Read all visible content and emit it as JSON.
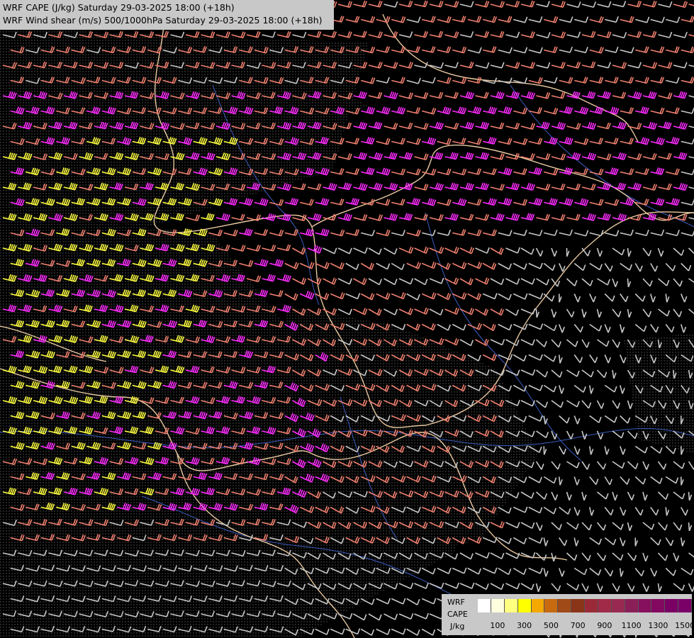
{
  "titles": {
    "line1": "WRF CAPE (J/kg) Saturday 29-03-2025 18:00 (+18h)",
    "line2": "WRF Wind shear (m/s) 500/1000hPa Saturday 29-03-2025 18:00 (+18h)"
  },
  "legend": {
    "label_1": "WRF",
    "label_2": "CAPE",
    "label_3": "J/kg",
    "swatch_colors": [
      "#ffffff",
      "#ffffe0",
      "#ffff80",
      "#ffff00",
      "#f5a800",
      "#c86a10",
      "#a04a18",
      "#8a3418",
      "#9a2a38",
      "#a02a48",
      "#982a52",
      "#8a1f58",
      "#86105e",
      "#820860",
      "#7a0064",
      "#7a0068"
    ],
    "tick_labels": [
      "100",
      "300",
      "500",
      "700",
      "900",
      "1100",
      "1300",
      "1500"
    ]
  },
  "colors": {
    "background": "#000000",
    "borders": "#e8c8a0",
    "rivers": "#4060c0",
    "shear_weak": "#c8c8c8",
    "shear_moderate": "#f08070",
    "shear_strong": "#ff2cff",
    "shear_cape_high": "#ffff40",
    "cape_hatch": "#bbbbbb"
  }
}
